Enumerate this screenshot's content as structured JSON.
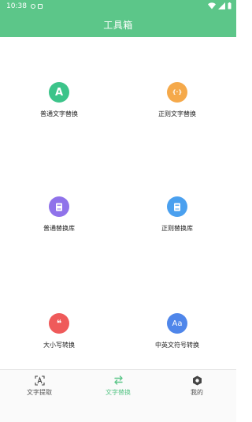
{
  "status": {
    "time": "10:38"
  },
  "header": {
    "title": "工具箱"
  },
  "tools": [
    {
      "label": "普通文字替换",
      "icon": "letter-a-icon",
      "color": "#3cc48a",
      "glyph": "A"
    },
    {
      "label": "正则文字替换",
      "icon": "regex-braces-icon",
      "color": "#f5a94a",
      "glyph": "{·}"
    },
    {
      "label": "普通替换库",
      "icon": "book-icon",
      "color": "#8f72ea"
    },
    {
      "label": "正则替换库",
      "icon": "book-icon",
      "color": "#4aa0ef"
    },
    {
      "label": "大小写转换",
      "icon": "quote-icon",
      "color": "#ef5a5a",
      "glyph": "❝"
    },
    {
      "label": "中英文符号转换",
      "icon": "aa-icon",
      "color": "#4f86ea",
      "glyph": "Aa"
    }
  ],
  "bottom_nav": [
    {
      "label": "文字提取",
      "icon": "text-scan-icon",
      "active": false
    },
    {
      "label": "文字替换",
      "icon": "swap-arrows-icon",
      "active": true
    },
    {
      "label": "我的",
      "icon": "hexagon-icon",
      "active": false
    }
  ],
  "colors": {
    "brand": "#5cc689",
    "active_tab": "#5cc689"
  }
}
